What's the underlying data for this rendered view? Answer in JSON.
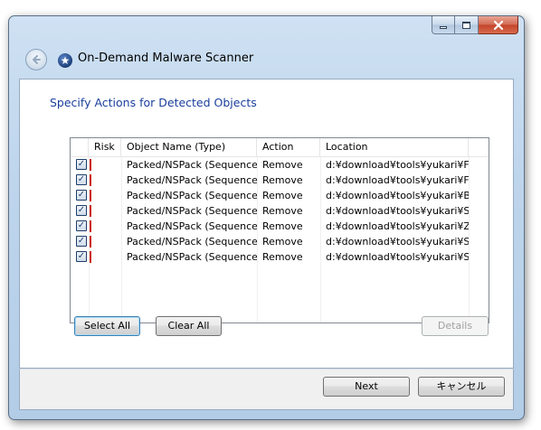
{
  "window": {
    "title": "On-Demand Malware Scanner",
    "caption_buttons": {
      "minimize_icon": "minimize-icon",
      "maximize_icon": "maximize-icon",
      "close_icon": "close-icon"
    },
    "back_icon": "back-arrow-icon",
    "app_icon": "malware-scanner-icon"
  },
  "page": {
    "heading": "Specify Actions for Detected Objects"
  },
  "list": {
    "columns": [
      "Risk",
      "Object Name (Type)",
      "Action",
      "Location"
    ],
    "rows": [
      {
        "checked": true,
        "risk": "high",
        "name": "Packed/NSPack (Sequence)",
        "action": "Remove",
        "location": "d:¥download¥tools¥yukari¥F..."
      },
      {
        "checked": true,
        "risk": "high",
        "name": "Packed/NSPack (Sequence)",
        "action": "Remove",
        "location": "d:¥download¥tools¥yukari¥F..."
      },
      {
        "checked": true,
        "risk": "high",
        "name": "Packed/NSPack (Sequence)",
        "action": "Remove",
        "location": "d:¥download¥tools¥yukari¥B..."
      },
      {
        "checked": true,
        "risk": "high",
        "name": "Packed/NSPack (Sequence)",
        "action": "Remove",
        "location": "d:¥download¥tools¥yukari¥S..."
      },
      {
        "checked": true,
        "risk": "high",
        "name": "Packed/NSPack (Sequence)",
        "action": "Remove",
        "location": "d:¥download¥tools¥yukari¥Z..."
      },
      {
        "checked": true,
        "risk": "high",
        "name": "Packed/NSPack (Sequence)",
        "action": "Remove",
        "location": "d:¥download¥tools¥yukari¥S..."
      },
      {
        "checked": true,
        "risk": "high",
        "name": "Packed/NSPack (Sequence)",
        "action": "Remove",
        "location": "d:¥download¥tools¥yukari¥S..."
      }
    ],
    "risk_color": "#cc2211"
  },
  "buttons": {
    "select_all": "Select All",
    "clear_all": "Clear All",
    "details": "Details",
    "next": "Next",
    "cancel": "キャンセル"
  },
  "colors": {
    "heading": "#1a3f9c",
    "frame": "#bed5ec",
    "close_button": "#c4442a"
  }
}
